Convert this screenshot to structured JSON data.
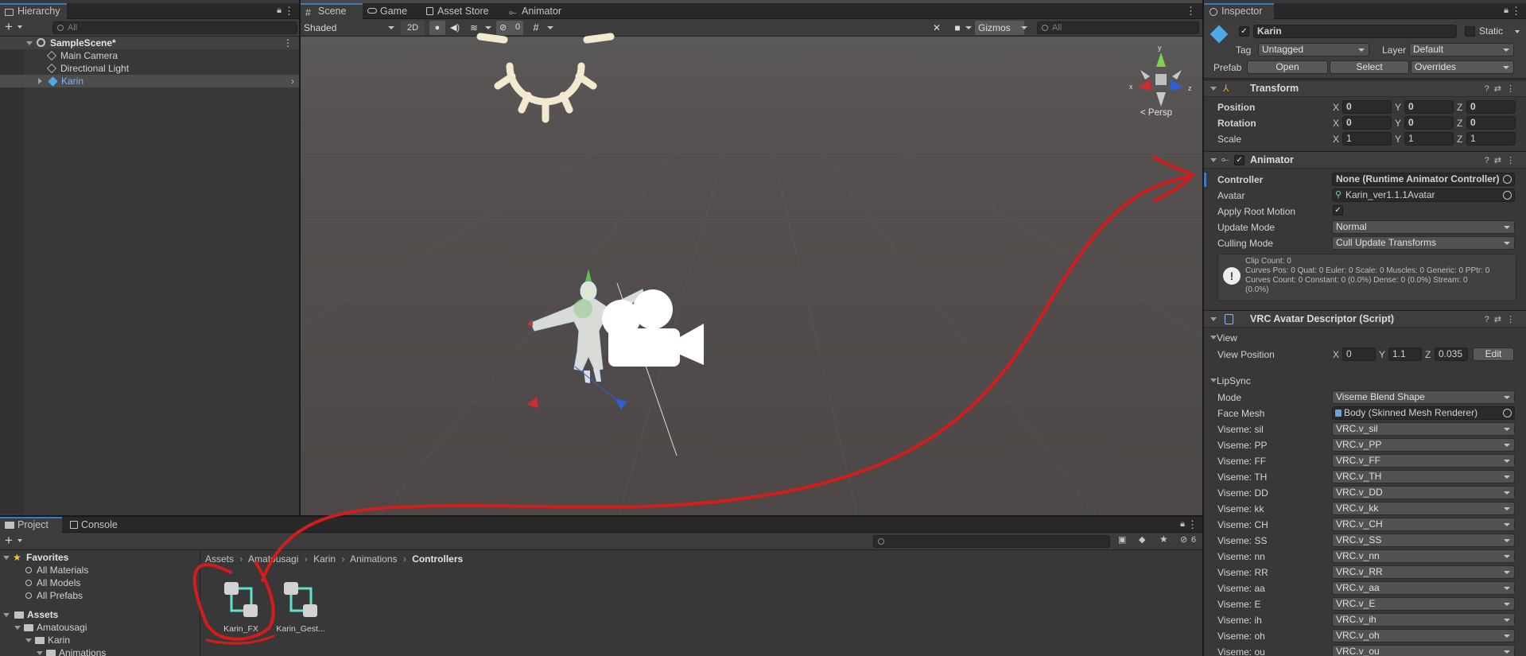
{
  "hierarchy": {
    "tab": "Hierarchy",
    "search_placeholder": "All",
    "scene": "SampleScene*",
    "items": [
      "Main Camera",
      "Directional Light",
      "Karin"
    ]
  },
  "scene_view": {
    "tabs": [
      "Scene",
      "Game",
      "Asset Store",
      "Animator"
    ],
    "shading_mode": "Shaded",
    "mode_2d": "2D",
    "hidden_count": "0",
    "gizmos_label": "Gizmos",
    "search_placeholder": "All",
    "persp_label": "Persp",
    "axis_y": "y",
    "axis_x": "x",
    "axis_z": "z"
  },
  "project": {
    "tabs": [
      "Project",
      "Console"
    ],
    "favorites_label": "Favorites",
    "favorites": [
      "All Materials",
      "All Models",
      "All Prefabs"
    ],
    "assets_label": "Assets",
    "tree": [
      "Amatousagi",
      "Karin",
      "Animations"
    ],
    "breadcrumb": [
      "Assets",
      "Amatousagi",
      "Karin",
      "Animations",
      "Controllers"
    ],
    "files": [
      "Karin_FX",
      "Karin_Gest..."
    ],
    "hidden_count": "6"
  },
  "inspector": {
    "tab": "Inspector",
    "object_name": "Karin",
    "static_label": "Static",
    "tag_label": "Tag",
    "tag_value": "Untagged",
    "layer_label": "Layer",
    "layer_value": "Default",
    "prefab_label": "Prefab",
    "prefab_open": "Open",
    "prefab_select": "Select",
    "prefab_overrides": "Overrides",
    "transform": {
      "title": "Transform",
      "rows": [
        {
          "label": "Position",
          "x": "0",
          "y": "0",
          "z": "0"
        },
        {
          "label": "Rotation",
          "x": "0",
          "y": "0",
          "z": "0"
        },
        {
          "label": "Scale",
          "x": "1",
          "y": "1",
          "z": "1"
        }
      ]
    },
    "animator": {
      "title": "Animator",
      "controller_label": "Controller",
      "controller_value": "None (Runtime Animator Controller)",
      "avatar_label": "Avatar",
      "avatar_value": "Karin_ver1.1.1Avatar",
      "root_motion_label": "Apply Root Motion",
      "update_mode_label": "Update Mode",
      "update_mode_value": "Normal",
      "culling_mode_label": "Culling Mode",
      "culling_mode_value": "Cull Update Transforms",
      "info_line1": "Clip Count: 0",
      "info_line2": "Curves Pos: 0 Quat: 0 Euler: 0 Scale: 0 Muscles: 0 Generic: 0 PPtr: 0",
      "info_line3": "Curves Count: 0 Constant: 0 (0.0%) Dense: 0 (0.0%) Stream: 0",
      "info_line4": "(0.0%)"
    },
    "vrc": {
      "title": "VRC Avatar Descriptor (Script)",
      "view_label": "View",
      "view_position_label": "View Position",
      "view_x": "0",
      "view_y": "1.1",
      "view_z": "0.035",
      "edit_label": "Edit",
      "lipsync_label": "LipSync",
      "mode_label": "Mode",
      "mode_value": "Viseme Blend Shape",
      "face_mesh_label": "Face Mesh",
      "face_mesh_value": "Body (Skinned Mesh Renderer)",
      "visemes": [
        {
          "label": "Viseme: sil",
          "value": "VRC.v_sil"
        },
        {
          "label": "Viseme: PP",
          "value": "VRC.v_PP"
        },
        {
          "label": "Viseme: FF",
          "value": "VRC.v_FF"
        },
        {
          "label": "Viseme: TH",
          "value": "VRC.v_TH"
        },
        {
          "label": "Viseme: DD",
          "value": "VRC.v_DD"
        },
        {
          "label": "Viseme: kk",
          "value": "VRC.v_kk"
        },
        {
          "label": "Viseme: CH",
          "value": "VRC.v_CH"
        },
        {
          "label": "Viseme: SS",
          "value": "VRC.v_SS"
        },
        {
          "label": "Viseme: nn",
          "value": "VRC.v_nn"
        },
        {
          "label": "Viseme: RR",
          "value": "VRC.v_RR"
        },
        {
          "label": "Viseme: aa",
          "value": "VRC.v_aa"
        },
        {
          "label": "Viseme: E",
          "value": "VRC.v_E"
        },
        {
          "label": "Viseme: ih",
          "value": "VRC.v_ih"
        },
        {
          "label": "Viseme: oh",
          "value": "VRC.v_oh"
        },
        {
          "label": "Viseme: ou",
          "value": "VRC.v_ou"
        }
      ]
    }
  },
  "colors": {
    "accent": "#3a79bb",
    "annotation": "#d41c1c",
    "teal_icon": "#5fe0d0"
  }
}
